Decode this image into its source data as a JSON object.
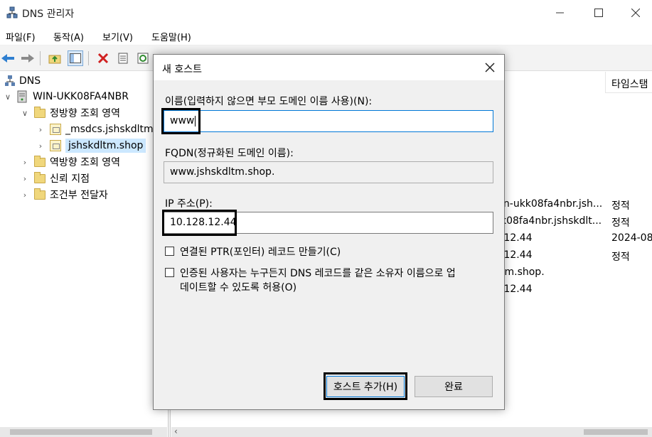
{
  "window": {
    "title": "DNS 관리자"
  },
  "menu": [
    "파일(F)",
    "동작(A)",
    "보기(V)",
    "도움말(H)"
  ],
  "tree": {
    "root": "DNS",
    "server": "WIN-UKK08FA4NBR",
    "forward_zones": "정방향 조회 영역",
    "zone_msdcs": "_msdcs.jshskdltm.",
    "zone_main": "jshskdltm.shop",
    "reverse_zones": "역방향 조회 영역",
    "trust_points": "신뢰 지점",
    "conditional_forwarders": "조건부 전달자"
  },
  "right_pane": {
    "column_timestamp": "타임스탬",
    "rows": [
      {
        "data": "in-ukk08fa4nbr.jsh...",
        "timestamp": "정적"
      },
      {
        "data": "k08fa4nbr.jshskdlt...",
        "timestamp": "정적"
      },
      {
        "data": ".12.44",
        "timestamp": "2024-08"
      },
      {
        "data": ".12.44",
        "timestamp": "정적"
      },
      {
        "data": "tm.shop.",
        "timestamp": ""
      },
      {
        "data": ".12.44",
        "timestamp": ""
      }
    ]
  },
  "dialog": {
    "title": "새 호스트",
    "name_label": "이름(입력하지 않으면 부모 도메인 이름 사용)(N):",
    "name_value": "www",
    "fqdn_label": "FQDN(정규화된 도메인 이름):",
    "fqdn_value": "www.jshskdltm.shop.",
    "ip_label": "IP 주소(P):",
    "ip_value": "10.128.12.44",
    "ptr_checkbox": "연결된 PTR(포인터) 레코드 만들기(C)",
    "auth_checkbox_line1": "인증된 사용자는 누구든지 DNS 레코드를 같은 소유자 이름으로 업",
    "auth_checkbox_line2": "데이트할 수 있도록 허용(O)",
    "add_host_button": "호스트 추가(H)",
    "done_button": "완료"
  }
}
